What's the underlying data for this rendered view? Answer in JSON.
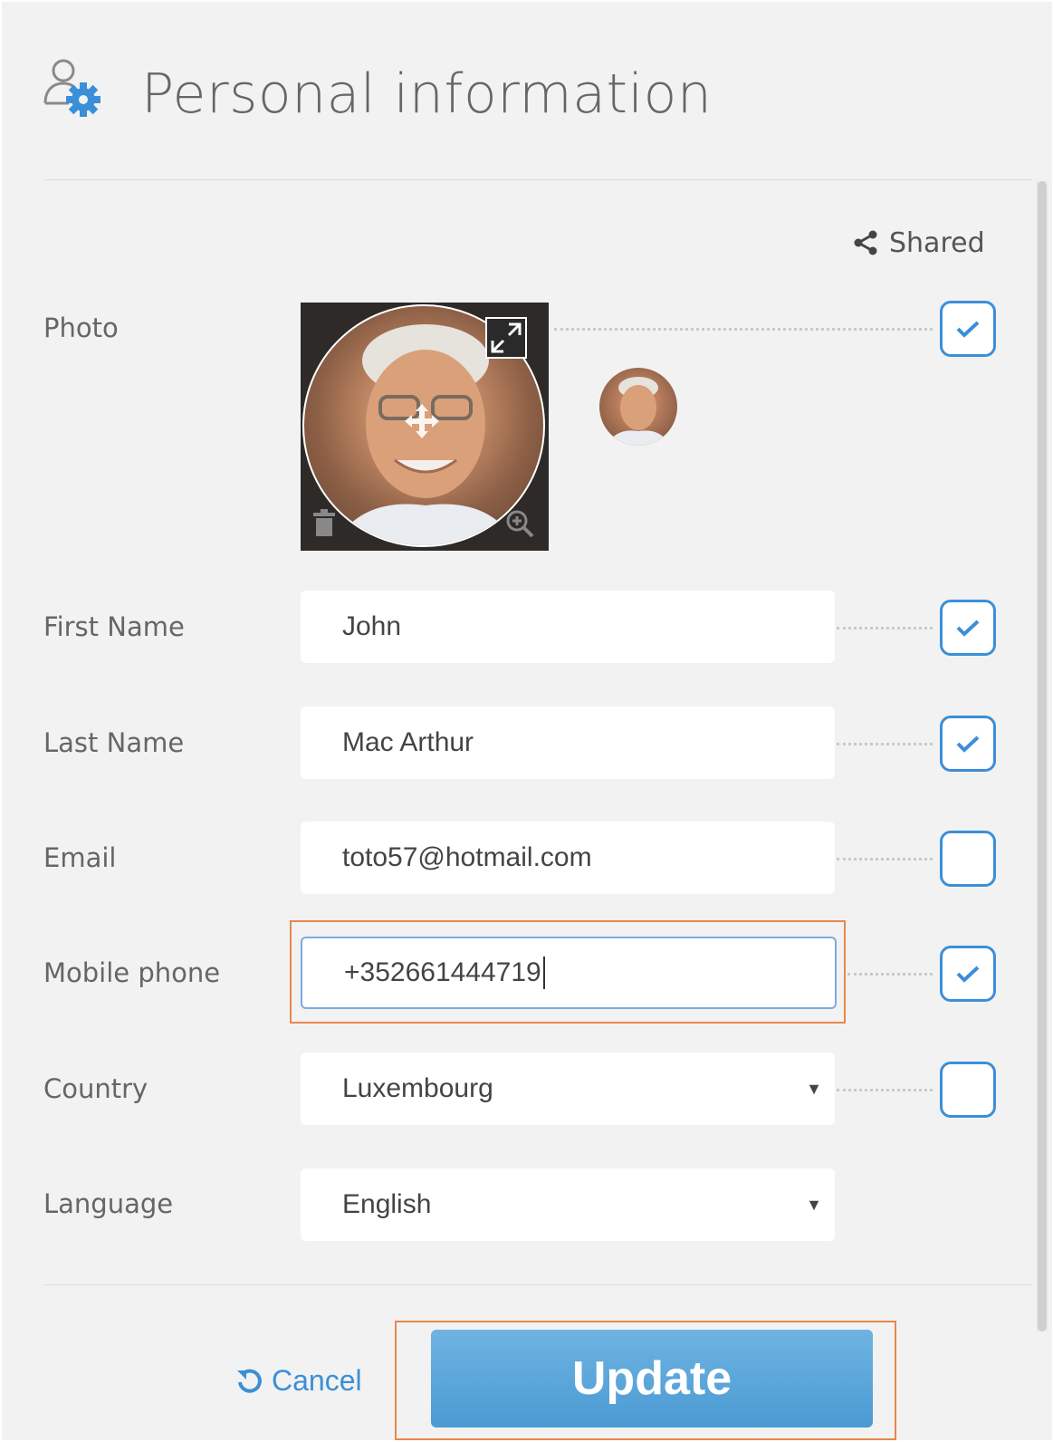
{
  "header": {
    "title": "Personal information",
    "icon": "user-gear-icon"
  },
  "shared": {
    "label": "Shared",
    "icon": "share-icon"
  },
  "photo": {
    "label": "Photo",
    "shared": true,
    "tools": [
      "expand-icon",
      "move-icon",
      "trash-icon",
      "zoom-in-icon"
    ]
  },
  "fields": {
    "first_name": {
      "label": "First Name",
      "value": "John",
      "shared": true
    },
    "last_name": {
      "label": "Last Name",
      "value": "Mac Arthur",
      "shared": true
    },
    "email": {
      "label": "Email",
      "value": "toto57@hotmail.com",
      "shared": false
    },
    "mobile": {
      "label": "Mobile phone",
      "value": "+352661444719",
      "shared": true,
      "focused": true
    },
    "country": {
      "label": "Country",
      "value": "Luxembourg",
      "shared": false
    },
    "language": {
      "label": "Language",
      "value": "English"
    }
  },
  "actions": {
    "cancel_label": "Cancel",
    "update_label": "Update"
  },
  "colors": {
    "accent": "#3b8fd9",
    "highlight": "#e8884b",
    "button": "#5aa5da"
  }
}
